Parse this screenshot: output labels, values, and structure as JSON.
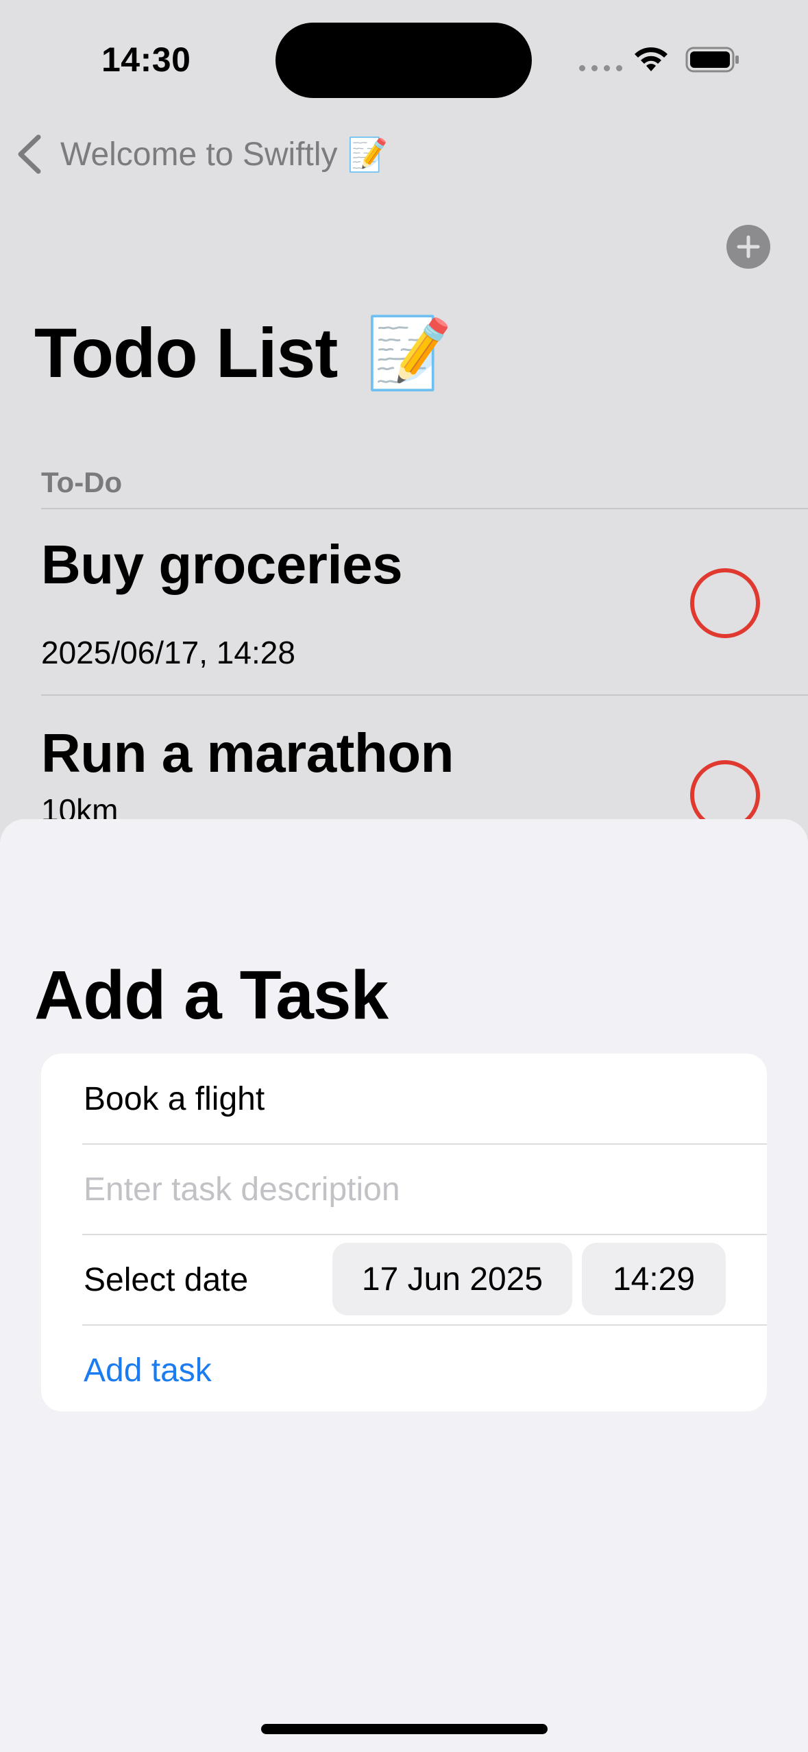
{
  "status_bar": {
    "time": "14:30"
  },
  "nav": {
    "back_label": "Welcome to Swiftly",
    "back_emoji": "📝",
    "add_icon": "plus-circle-icon"
  },
  "page": {
    "title": "Todo List",
    "title_emoji": "📝"
  },
  "todo_section": {
    "header": "To-Do",
    "tasks": [
      {
        "title": "Buy groceries",
        "subtitle": "2025/06/17, 14:28",
        "completed": false
      },
      {
        "title": "Run a marathon",
        "subtitle": "10km",
        "completed": false
      }
    ]
  },
  "add_task_sheet": {
    "title": "Add a Task",
    "name_value": "Book a flight",
    "description_placeholder": "Enter task description",
    "date_label": "Select date",
    "date_value": "17 Jun 2025",
    "time_value": "14:29",
    "submit_label": "Add task"
  },
  "colors": {
    "accent_blue": "#1a7cf0",
    "incomplete_circle": "#e03a30"
  }
}
